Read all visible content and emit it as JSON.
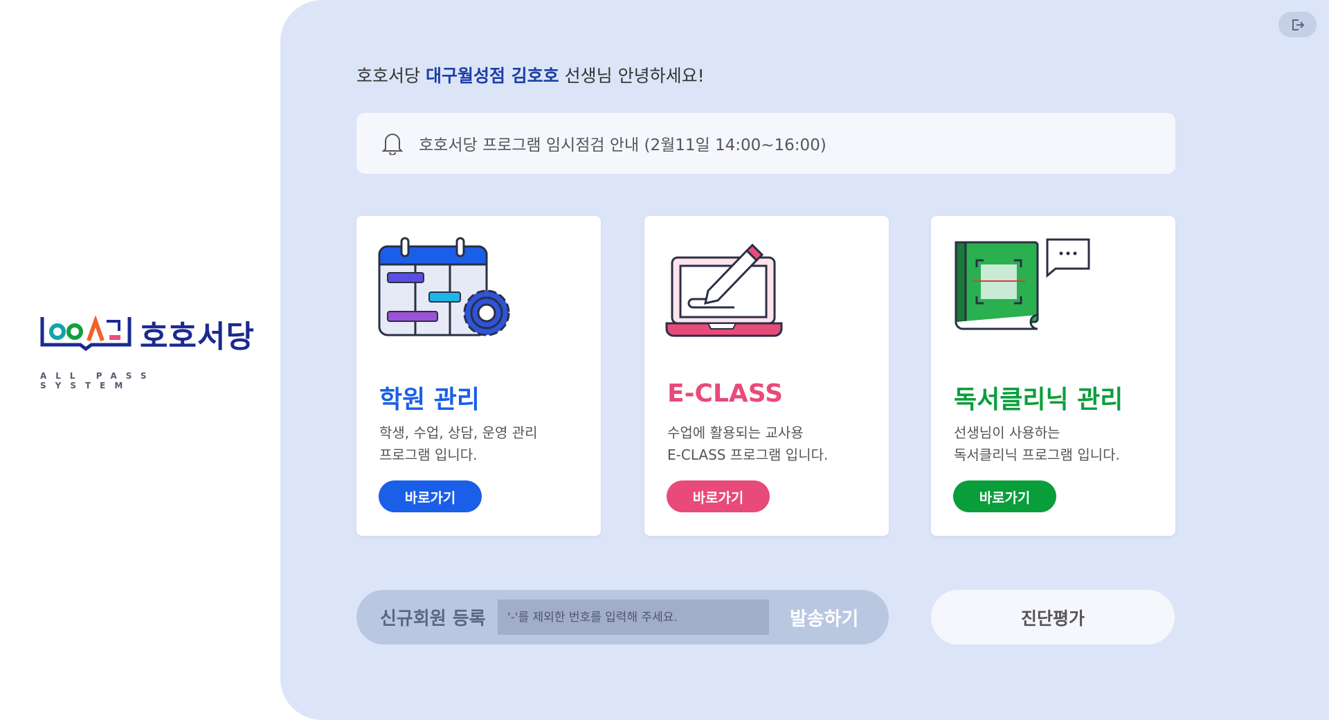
{
  "logo": {
    "brand": "호호서당",
    "tagline": "ALL PASS SYSTEM"
  },
  "header": {
    "greet_prefix": "호호서당 ",
    "greet_name": "대구월성점 김호호",
    "greet_suffix": " 선생님 안녕하세요!"
  },
  "notice": {
    "text": "호호서당 프로그램 임시점검 안내 (2월11일 14:00~16:00)"
  },
  "cards": [
    {
      "title": "학원 관리",
      "desc": "학생, 수업, 상담, 운영 관리\n프로그램 입니다.",
      "button": "바로가기",
      "color": "#1a5fe8"
    },
    {
      "title": "E-CLASS",
      "desc": "수업에 활용되는 교사용\nE-CLASS 프로그램 입니다.",
      "button": "바로가기",
      "color": "#e84a7a"
    },
    {
      "title": "독서클리닉 관리",
      "desc": "선생님이 사용하는\n독서클리닉 프로그램 입니다.",
      "button": "바로가기",
      "color": "#0a9e3b"
    }
  ],
  "register": {
    "label": "신규회원 등록",
    "placeholder": "'-'를 제외한 번호를 입력해 주세요.",
    "send": "발송하기"
  },
  "diagnosis": {
    "label": "진단평가"
  }
}
